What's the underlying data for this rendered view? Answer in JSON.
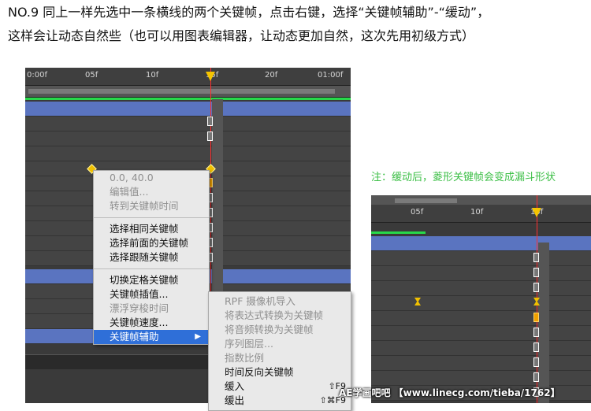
{
  "instruction": {
    "line1": "NO.9  同上一样先选中一条横线的两个关键帧，点击右键，选择“关键帧辅助”-“缓动”，",
    "line2": "这样会让动态自然些（也可以用图表编辑器，让动态更加自然，这次先用初级方式）"
  },
  "timeline_main": {
    "ruler_ticks": [
      "0:00f",
      "05f",
      "10f",
      "15f",
      "20f",
      "01:00f"
    ]
  },
  "context_menu": {
    "value_label": "0.0, 40.0",
    "edit_value": "编辑值...",
    "goto_time": "转到关键帧时间",
    "select_same": "选择相同关键帧",
    "select_previous": "选择前面的关键帧",
    "select_following": "选择跟随关键帧",
    "toggle_hold": "切换定格关键帧",
    "interpolation": "关键帧插值...",
    "rove_across_time": "漂浮穿梭时间",
    "velocity": "关键帧速度...",
    "assistant": "关键帧辅助",
    "submenu_arrow": "▶"
  },
  "submenu": {
    "rpf_camera": "RPF 摄像机导入",
    "expr_to_keyframes": "将表达式转换为关键帧",
    "audio_to_keyframes": "将音频转换为关键帧",
    "sequence_layers": "序列图层...",
    "exponential_scale": "指数比例",
    "time_reverse": "时间反向关键帧",
    "ease_in": "缓入",
    "ease_in_shortcut": "⇧F9",
    "ease_out": "缓出",
    "ease_out_shortcut": "⇧⌘F9"
  },
  "note": "注：缓动后，菱形关键帧会变成漏斗形状",
  "timeline_result": {
    "ruler_ticks": [
      "05f",
      "10f",
      "15f"
    ]
  },
  "watermark": "AE学画吧吧  【www.linecg.com/tieba/1762】",
  "colors": {
    "note_green": "#3cbf46",
    "playhead_red": "#ff2f2f",
    "layer_blue": "#5a74c0",
    "menu_highlight": "#2f6fd8",
    "keyframe_gold": "#f0c000"
  }
}
